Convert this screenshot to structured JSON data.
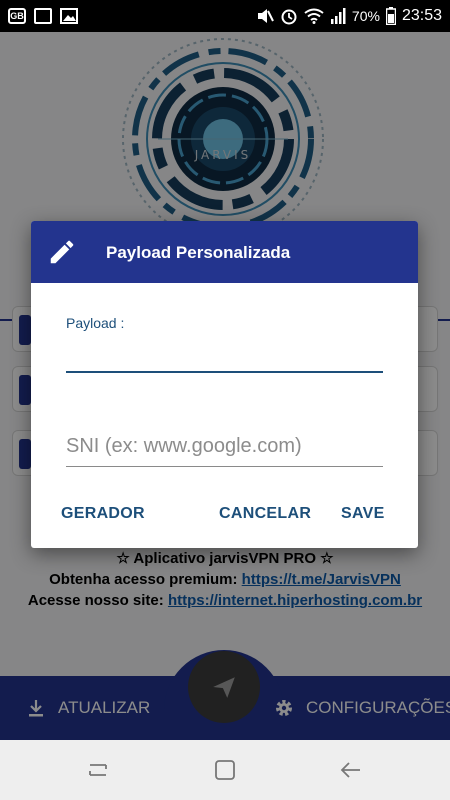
{
  "status_bar": {
    "notification_icons": [
      "carrier-icon",
      "image-icon",
      "gallery-icon"
    ],
    "system_icons": [
      "mute-icon",
      "alarm-icon",
      "wifi-icon",
      "signal-icon"
    ],
    "battery": "70%",
    "time": "23:53"
  },
  "background": {
    "logo_text": "JARVIS",
    "promo_line1": "☆ Aplicativo jarvisVPN PRO ☆",
    "promo_line2_prefix": "Obtenha acesso premium: ",
    "promo_line2_link": "https://t.me/JarvisVPN",
    "promo_line3_prefix": "Acesse nosso site: ",
    "promo_line3_link": "https://internet.hiperhosting.com.br",
    "bottom_bar": {
      "update_label": "ATUALIZAR",
      "settings_label": "CONFIGURAÇÕES"
    }
  },
  "dialog": {
    "title": "Payload Personalizada",
    "payload_label": "Payload :",
    "payload_value": "",
    "sni_placeholder": "SNI (ex: www.google.com)",
    "sni_value": "",
    "generator_button": "GERADOR",
    "cancel_button": "CANCELAR",
    "save_button": "SAVE"
  },
  "colors": {
    "primary": "#23348e",
    "accent_text": "#1d4f7a",
    "link": "#0d5aa8"
  }
}
